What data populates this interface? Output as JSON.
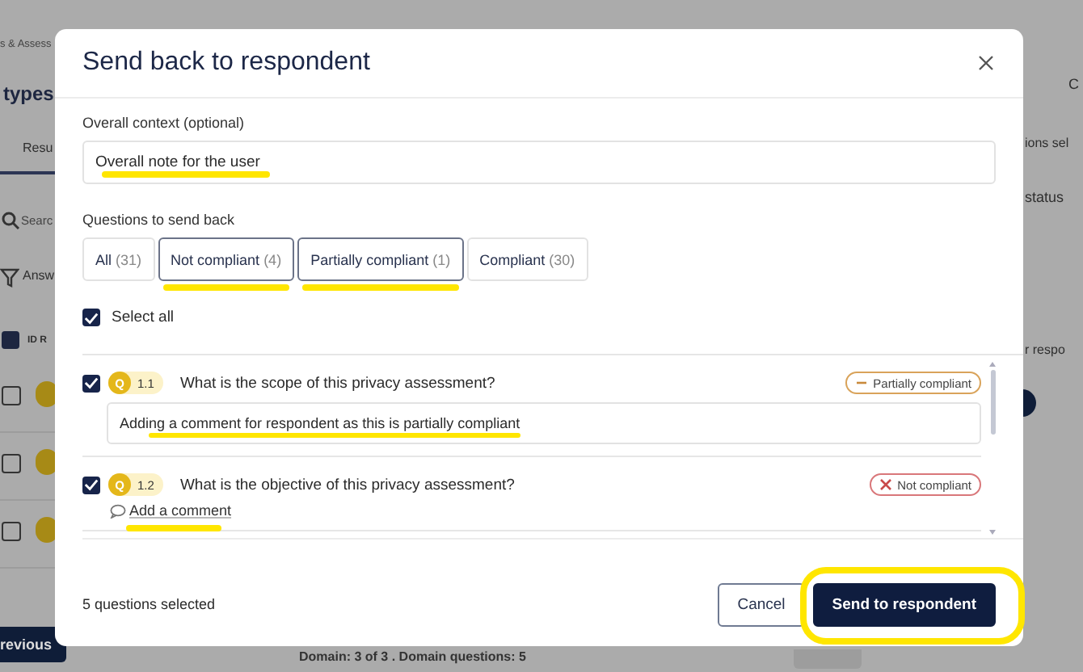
{
  "background": {
    "breadcrumb": "s & Assess",
    "heading": "types",
    "tab": "Resu",
    "search_placeholder": "Searc",
    "filter": "Answ",
    "column": "ID R",
    "header_checked": true,
    "rows": [
      {
        "checked": false
      },
      {
        "checked": false
      },
      {
        "checked": false
      }
    ],
    "previous": "revious",
    "footer": "Domain: 3 of 3  .  Domain questions: 5",
    "right_texts": [
      "C",
      "ions sel",
      "status",
      "r respo"
    ]
  },
  "dialog": {
    "title": "Send back to respondent",
    "context": {
      "label": "Overall context (optional)",
      "value": "Overall note for the user",
      "highlighted": true
    },
    "questions_label": "Questions to send back",
    "filters": [
      {
        "label": "All",
        "count": "(31)",
        "selected": false,
        "highlighted": false
      },
      {
        "label": "Not compliant",
        "count": "(4)",
        "selected": true,
        "highlighted": true
      },
      {
        "label": "Partially compliant",
        "count": "(1)",
        "selected": true,
        "highlighted": true
      },
      {
        "label": "Compliant",
        "count": "(30)",
        "selected": false,
        "highlighted": false
      }
    ],
    "select_all": {
      "label": "Select all",
      "checked": true
    },
    "questions": [
      {
        "checked": true,
        "badge": "Q",
        "number": "1.1",
        "text": "What is the scope of this privacy assessment?",
        "status": {
          "kind": "partial",
          "label": "Partially compliant"
        },
        "comment": "Adding a comment for respondent as this is partially compliant",
        "highlighted": true
      },
      {
        "checked": true,
        "badge": "Q",
        "number": "1.2",
        "text": "What is the objective of this privacy assessment?",
        "status": {
          "kind": "not",
          "label": "Not compliant"
        },
        "add_comment": "Add a comment",
        "highlighted": true
      }
    ],
    "selected_count": "5 questions selected",
    "buttons": [
      {
        "kind": "secondary",
        "label": "Cancel",
        "circled": false
      },
      {
        "kind": "primary",
        "label": "Send to respondent",
        "circled": true
      }
    ]
  }
}
